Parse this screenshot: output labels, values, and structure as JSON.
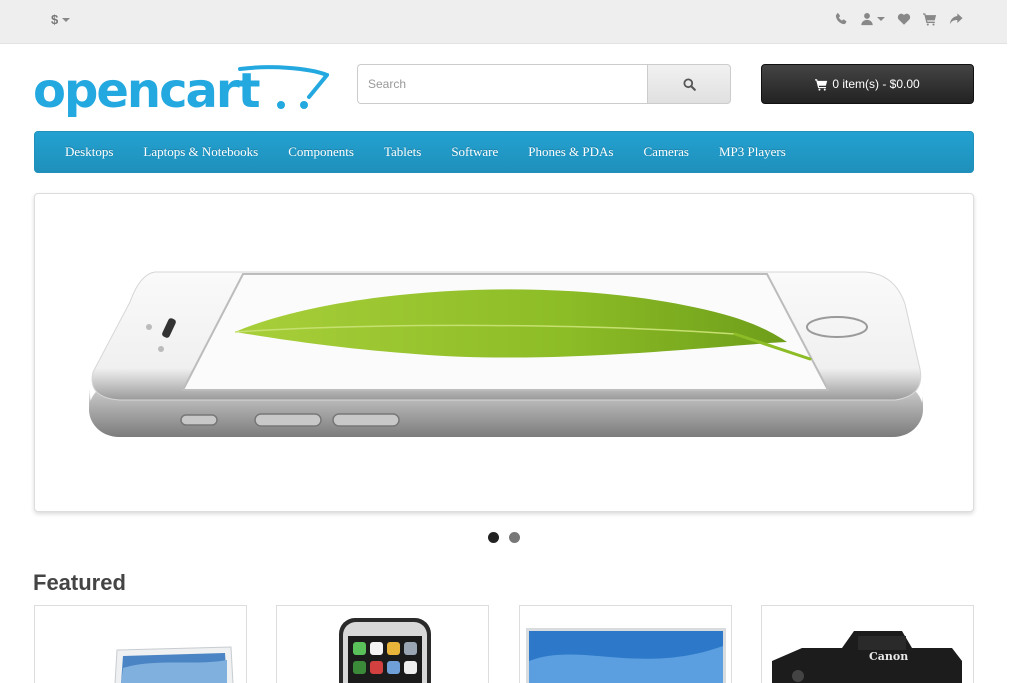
{
  "topbar": {
    "currency_symbol": "$",
    "icons": [
      "phone-icon",
      "user-icon",
      "heart-icon",
      "shopping-cart-icon",
      "share-icon"
    ]
  },
  "header": {
    "logo_text": "opencart",
    "search": {
      "placeholder": "Search",
      "value": ""
    },
    "cart_label": "0 item(s) - $0.00"
  },
  "menu": {
    "items": [
      "Desktops",
      "Laptops & Notebooks",
      "Components",
      "Tablets",
      "Software",
      "Phones & PDAs",
      "Cameras",
      "MP3 Players"
    ]
  },
  "slideshow": {
    "slide_count": 2,
    "active_index": 0
  },
  "featured": {
    "title": "Featured",
    "products": [
      {
        "name": "laptop",
        "camera_brand": ""
      },
      {
        "name": "iphone",
        "camera_brand": ""
      },
      {
        "name": "monitor",
        "camera_brand": ""
      },
      {
        "name": "camera",
        "camera_brand": "Canon"
      }
    ]
  },
  "colors": {
    "menu_blue": "#229ac8",
    "logo_blue": "#23a8e0",
    "cart_dark": "#333333"
  }
}
